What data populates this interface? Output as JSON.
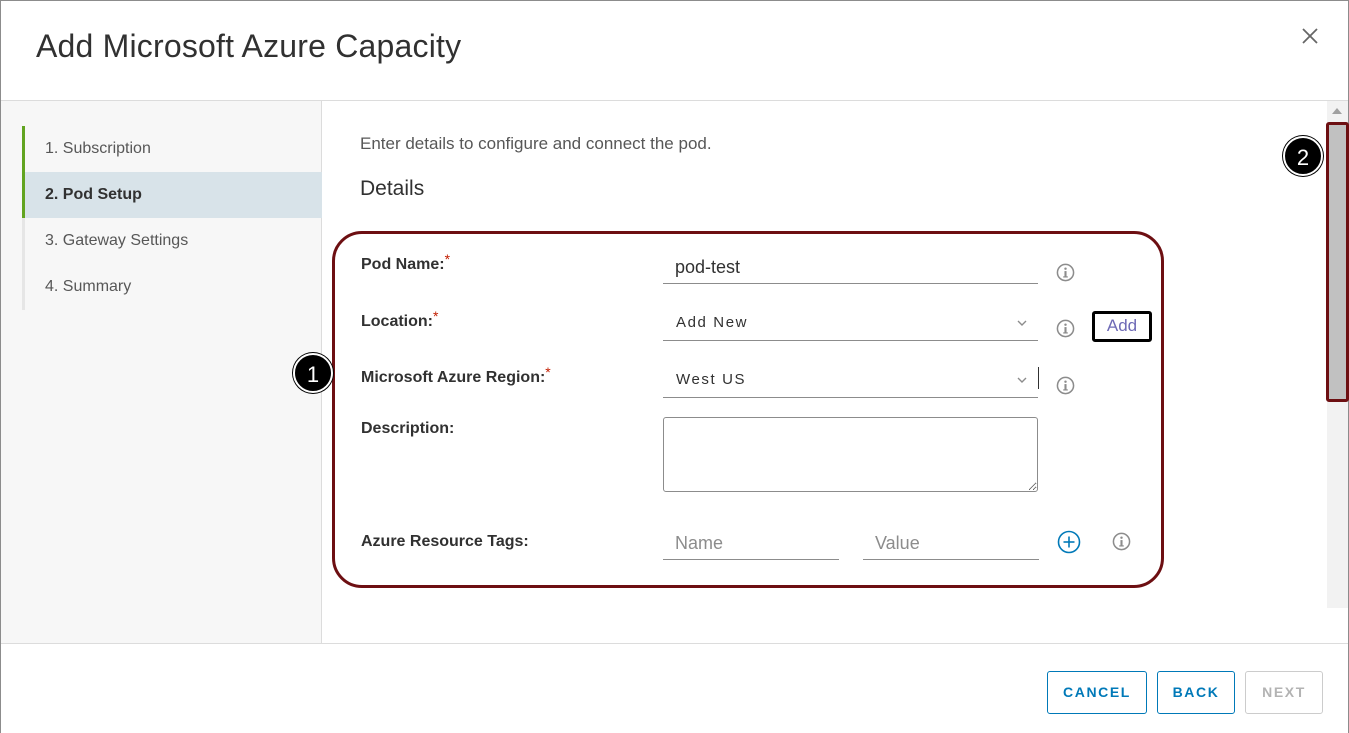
{
  "dialog": {
    "title": "Add Microsoft Azure Capacity"
  },
  "sidebar": {
    "steps": [
      {
        "label": "1. Subscription",
        "state": "done"
      },
      {
        "label": "2. Pod Setup",
        "state": "active"
      },
      {
        "label": "3. Gateway Settings",
        "state": "pending"
      },
      {
        "label": "4. Summary",
        "state": "pending"
      }
    ]
  },
  "main": {
    "intro": "Enter details to configure and connect the pod.",
    "section_title": "Details",
    "fields": {
      "pod_name": {
        "label": "Pod Name:",
        "required": "*",
        "value": "pod-test"
      },
      "location": {
        "label": "Location:",
        "required": "*",
        "value": "Add New",
        "add_label": "Add"
      },
      "region": {
        "label": "Microsoft Azure Region:",
        "required": "*",
        "value": "West US"
      },
      "description": {
        "label": "Description:",
        "value": ""
      },
      "tags": {
        "label": "Azure Resource Tags:",
        "name_placeholder": "Name",
        "value_placeholder": "Value"
      }
    }
  },
  "annotations": {
    "badge1": "1",
    "badge2": "2"
  },
  "footer": {
    "cancel": "CANCEL",
    "back": "BACK",
    "next": "NEXT"
  },
  "colors": {
    "accent": "#0079b8",
    "step_done": "#62a420",
    "annotation_frame": "#6d0f12",
    "required": "#c21d00"
  }
}
